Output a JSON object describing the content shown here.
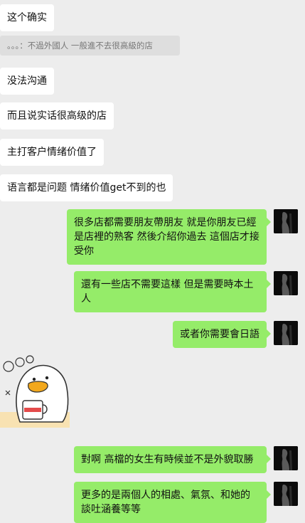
{
  "messages": [
    {
      "side": "in",
      "text": "这个确实"
    },
    {
      "side": "quote",
      "text": "。。。：不過外國人 一般進不去很高級的店"
    },
    {
      "side": "in",
      "text": "没法沟通"
    },
    {
      "side": "in",
      "text": "而且说实话很高级的店"
    },
    {
      "side": "in",
      "text": "主打客户情绪价值了"
    },
    {
      "side": "in",
      "text": "语言都是问题 情绪价值get不到的也"
    },
    {
      "side": "out",
      "text": "很多店都需要朋友帶朋友  就是你朋友已經是店裡的熟客  然後介紹你過去  這個店才接受你"
    },
    {
      "side": "out",
      "text": "還有一些店不需要這樣   但是需要時本土人"
    },
    {
      "side": "out",
      "text": "或者你需要會日語"
    },
    {
      "side": "sticker",
      "text": "duck-with-cup-sticker"
    },
    {
      "side": "out",
      "text": "對啊   高檔的女生有時候並不是外貌取勝"
    },
    {
      "side": "out",
      "text": "更多的是兩個人的相處、氣氛、和她的談吐涵養等等"
    }
  ],
  "colors": {
    "background": "#ededed",
    "incoming_bubble": "#ffffff",
    "outgoing_bubble": "#95ec69",
    "quote_background": "#dedede"
  },
  "icons": {
    "self_avatar": "dark-silhouette-avatar",
    "sticker": "duck-holding-mug-sticker"
  }
}
